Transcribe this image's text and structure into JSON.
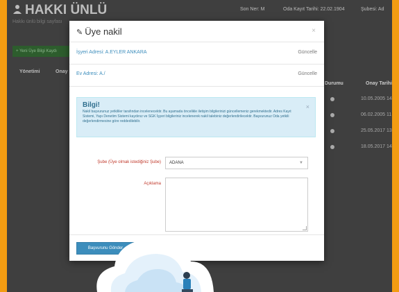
{
  "page": {
    "title": "HAKKI ÜNLÜ",
    "subtitle": "Hakkı ünlü bilgi sayfası",
    "top_info": [
      "Son Ner: M",
      "Oda Kayıt Tarihi: 22.02.1904",
      "Şubesi: Ad"
    ],
    "green_button": "+ Yeni Üye Bilgi Kaydı",
    "tabs": [
      "Yönetimi",
      "Onay"
    ],
    "table_headers": [
      "Durumu",
      "Onay Tarihi"
    ],
    "table_dates": [
      "10.05.2005 14",
      "06.02.2005 11",
      "25.05.2017 13",
      "18.05.2017 14"
    ]
  },
  "modal": {
    "title": "Üye nakil",
    "close": "×",
    "workplace_address": "İşyeri Adresi: A.EYLER ANKARA",
    "home_address": "Ev Adresi: A./",
    "update_label": "Güncelle",
    "alert": {
      "title": "Bilgi!",
      "text": "Nakil başvurunuz yetkililer tarafından incelenecektir. Bu aşamada öncelikle iletişim bilgilerinizi güncellemeniz gerekmektedir. Adres Kayıt Sistemi, Yapı Denetim Sistemi kaydınız ve SGK İşyeri bilgileriniz incelenerek nakil talebiniz değerlendirilecektir. Başvurunuz Oda yetkili değerlendirmesine göre reddedilebilir.",
      "close": "×"
    },
    "branch_label": "Şube (Üye olmak istediğiniz Şube)",
    "branch_value": "ADANA",
    "description_label": "Açıklama",
    "submit_label": "Başvurunu Gönder"
  },
  "colors": {
    "frame_border": "#f39c12",
    "primary": "#3c8dbc",
    "alert_bg": "#d9edf7",
    "required_label": "#c0392b"
  }
}
